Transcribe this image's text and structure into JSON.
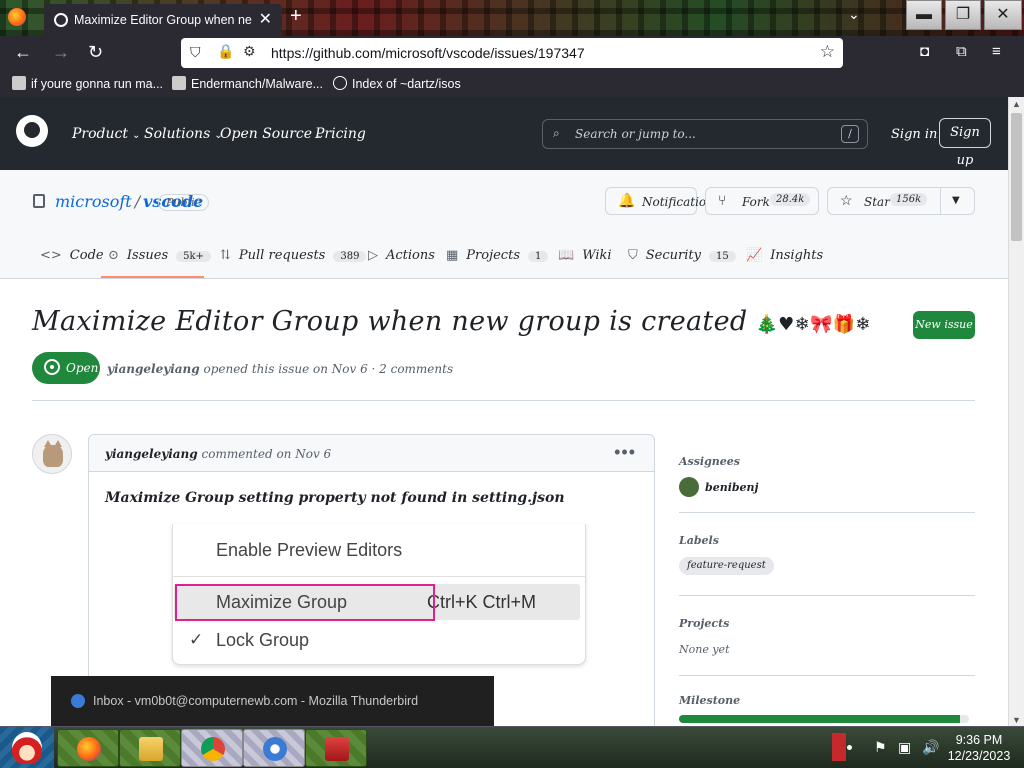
{
  "browser": {
    "tab_title": "Maximize Editor Group when new group is created",
    "url": "https://github.com/microsoft/vscode/issues/197347",
    "bookmarks": [
      {
        "label": "if youre gonna run ma..."
      },
      {
        "label": "Endermanch/Malware..."
      },
      {
        "label": "Index of ~dartz/isos"
      }
    ]
  },
  "github": {
    "nav": [
      "Product",
      "Solutions",
      "Open Source",
      "Pricing"
    ],
    "search_placeholder": "Search or jump to...",
    "search_shortcut": "/",
    "sign_in": "Sign in",
    "sign_up": "Sign up"
  },
  "repo": {
    "owner": "microsoft",
    "separator": "/",
    "name": "vscode",
    "visibility": "Public",
    "notifications_label": "Notifications",
    "fork_label": "Fork",
    "fork_count": "28.4k",
    "star_label": "Star",
    "star_count": "156k",
    "tabs": [
      {
        "label": "Code",
        "count": ""
      },
      {
        "label": "Issues",
        "count": "5k+"
      },
      {
        "label": "Pull requests",
        "count": "389"
      },
      {
        "label": "Actions",
        "count": ""
      },
      {
        "label": "Projects",
        "count": "1"
      },
      {
        "label": "Wiki",
        "count": ""
      },
      {
        "label": "Security",
        "count": "15"
      },
      {
        "label": "Insights",
        "count": ""
      }
    ]
  },
  "issue": {
    "title": "Maximize Editor Group when new group is created",
    "title_decoration": "🎄♥❄🎀🎁❄",
    "new_issue_label": "New issue",
    "state": "Open",
    "meta_author": "yiangeleyiang",
    "meta_text": "opened this issue on Nov 6 · 2 comments"
  },
  "comment": {
    "author": "yiangeleyiang",
    "date_text": "commented on Nov 6",
    "body": "Maximize Group setting property not found in setting.json",
    "screenshot_menu": {
      "item1": "Enable Preview Editors",
      "item2": "Maximize Group",
      "item2_shortcut": "Ctrl+K Ctrl+M",
      "item3": "Lock Group",
      "item3_check": "✓"
    }
  },
  "sidebar": {
    "assignees_heading": "Assignees",
    "assignee": "benibenj",
    "labels_heading": "Labels",
    "label": "feature-request",
    "projects_heading": "Projects",
    "projects_value": "None yet",
    "milestone_heading": "Milestone",
    "milestone_progress": 0.97
  },
  "notification": {
    "text": "Inbox - vm0b0t@computernewb.com - Mozilla Thunderbird"
  },
  "taskbar": {
    "time": "9:36 PM",
    "date": "12/23/2023"
  }
}
